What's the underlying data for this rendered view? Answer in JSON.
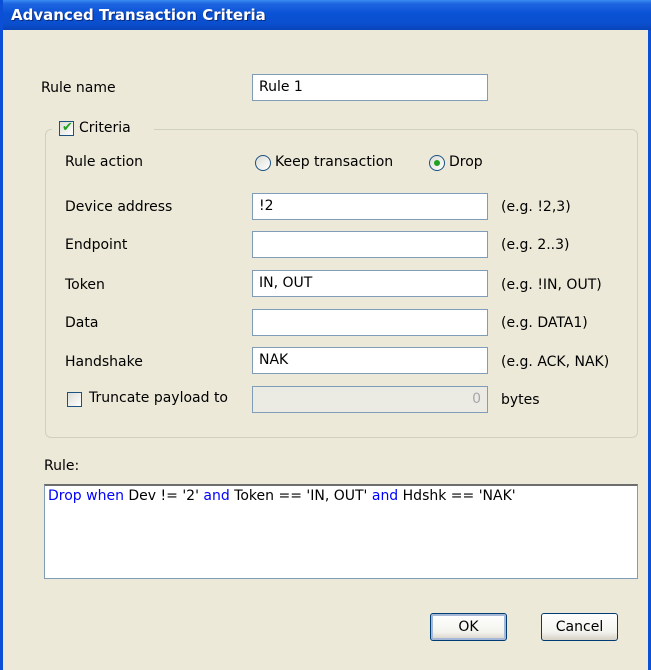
{
  "window": {
    "title": "Advanced Transaction Criteria"
  },
  "rule_name": {
    "label": "Rule name",
    "value": "Rule 1"
  },
  "criteria": {
    "checkbox_label": "Criteria",
    "checked": true,
    "rule_action": {
      "label": "Rule action",
      "options": [
        "Keep transaction",
        "Drop"
      ],
      "selected": "Drop"
    },
    "fields": [
      {
        "label": "Device address",
        "value": "!2",
        "example": "(e.g. !2,3)"
      },
      {
        "label": "Endpoint",
        "value": "",
        "example": "(e.g. 2..3)"
      },
      {
        "label": "Token",
        "value": "IN, OUT",
        "example": "(e.g. !IN, OUT)"
      },
      {
        "label": "Data",
        "value": "",
        "example": "(e.g. DATA1)"
      },
      {
        "label": "Handshake",
        "value": "NAK",
        "example": "(e.g. ACK, NAK)"
      }
    ],
    "truncate": {
      "label": "Truncate payload to",
      "checked": false,
      "value": "0",
      "unit": "bytes"
    }
  },
  "rule": {
    "label": "Rule:",
    "parts": [
      {
        "text": "Drop when",
        "kw": true
      },
      {
        "text": " Dev != '2' ",
        "kw": false
      },
      {
        "text": "and",
        "kw": true
      },
      {
        "text": " Token == 'IN, OUT' ",
        "kw": false
      },
      {
        "text": "and",
        "kw": true
      },
      {
        "text": " Hdshk == 'NAK'",
        "kw": false
      }
    ]
  },
  "buttons": {
    "ok": "OK",
    "cancel": "Cancel"
  },
  "colors": {
    "titlebar": "#0a52d6",
    "keyword": "#0000ff",
    "check": "#21a121",
    "dialog_bg": "#ece9d8"
  }
}
